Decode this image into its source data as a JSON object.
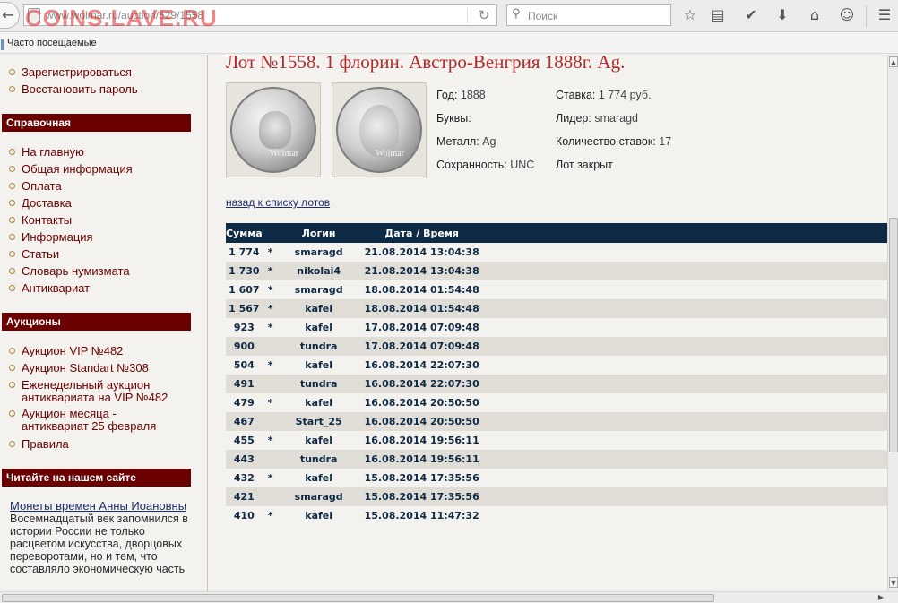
{
  "browser": {
    "url": "www.wolmar.ru/auction/529/1558",
    "watermark": "COINS.LAVE.RU",
    "search_placeholder": "Поиск",
    "bookmarks_label": "Часто посещаемые"
  },
  "sidebar": {
    "account_links": [
      "Зарегистрироваться",
      "Восстановить пароль"
    ],
    "sections": [
      {
        "title": "Справочная",
        "items": [
          "На главную",
          "Общая информация",
          "Оплата",
          "Доставка",
          "Контакты",
          "Информация",
          "Статьи",
          "Словарь нумизмата",
          "Антиквариат"
        ]
      },
      {
        "title": "Аукционы",
        "items": [
          "Аукцион VIP №482",
          "Аукцион Standart №308",
          "Еженедельный аукцион антиквариата на VIP №482",
          "Аукцион месяца - антиквариат 25 февраля",
          "Правила"
        ]
      },
      {
        "title": "Читайте на нашем сайте"
      }
    ],
    "article": {
      "title": "Монеты времен Анны Иоановны",
      "text": "Восемнадцатый век запомнился в истории России не только расцветом искусства, дворцовых переворотами, но и тем, что составляло экономическую часть"
    }
  },
  "lot": {
    "title": "Лот №1558.  1 флорин. Австро-Венгрия 1888г. Ag.",
    "image_watermark": "Wolmar",
    "info": {
      "year_label": "Год:",
      "year": "1888",
      "letters_label": "Буквы:",
      "letters": "",
      "metal_label": "Металл:",
      "metal": "Ag",
      "condition_label": "Сохранность:",
      "condition": "UNC",
      "bid_label": "Ставка:",
      "bid": "1 774 руб.",
      "leader_label": "Лидер:",
      "leader": "smaragd",
      "bids_count_label": "Количество ставок:",
      "bids_count": "17",
      "status": "Лот закрыт"
    },
    "back_link": "назад к списку лотов"
  },
  "bids_table": {
    "headers": [
      "Сумма",
      "Логин",
      "Дата / Время"
    ],
    "rows": [
      {
        "sum": "1 774",
        "star": "*",
        "login": "smaragd",
        "datetime": "21.08.2014 13:04:38"
      },
      {
        "sum": "1 730",
        "star": "*",
        "login": "nikolai4",
        "datetime": "21.08.2014 13:04:38"
      },
      {
        "sum": "1 607",
        "star": "*",
        "login": "smaragd",
        "datetime": "18.08.2014 01:54:48"
      },
      {
        "sum": "1 567",
        "star": "*",
        "login": "kafel",
        "datetime": "18.08.2014 01:54:48"
      },
      {
        "sum": "923",
        "star": "*",
        "login": "kafel",
        "datetime": "17.08.2014 07:09:48"
      },
      {
        "sum": "900",
        "star": "",
        "login": "tundra",
        "datetime": "17.08.2014 07:09:48"
      },
      {
        "sum": "504",
        "star": "*",
        "login": "kafel",
        "datetime": "16.08.2014 22:07:30"
      },
      {
        "sum": "491",
        "star": "",
        "login": "tundra",
        "datetime": "16.08.2014 22:07:30"
      },
      {
        "sum": "479",
        "star": "*",
        "login": "kafel",
        "datetime": "16.08.2014 20:50:50"
      },
      {
        "sum": "467",
        "star": "",
        "login": "Start_25",
        "datetime": "16.08.2014 20:50:50"
      },
      {
        "sum": "455",
        "star": "*",
        "login": "kafel",
        "datetime": "16.08.2014 19:56:11"
      },
      {
        "sum": "443",
        "star": "",
        "login": "tundra",
        "datetime": "16.08.2014 19:56:11"
      },
      {
        "sum": "432",
        "star": "*",
        "login": "kafel",
        "datetime": "15.08.2014 17:35:56"
      },
      {
        "sum": "421",
        "star": "",
        "login": "smaragd",
        "datetime": "15.08.2014 17:35:56"
      },
      {
        "sum": "410",
        "star": "*",
        "login": "kafel",
        "datetime": "15.08.2014 11:47:32"
      }
    ]
  },
  "colors": {
    "section_header": "#6b0000",
    "sidebar_link": "#6a0000",
    "lot_title": "#b22a2a",
    "table_header": "#0e2a45",
    "row_alt": "#e0ddd6"
  }
}
